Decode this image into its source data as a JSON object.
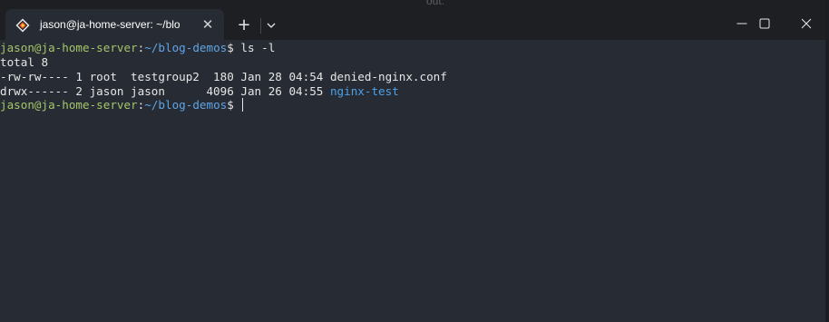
{
  "background_text": "out.",
  "tab": {
    "title": "jason@ja-home-server: ~/blo",
    "icon": "linux-penguin-icon"
  },
  "toolbar": {
    "new_tab_label": "+",
    "close_tab_label": "✕"
  },
  "colors": {
    "terminal_bg": "#272b33",
    "prompt_user": "#a4c66a",
    "prompt_path": "#5fa5e6",
    "directory": "#4ea0e8",
    "text": "#e6e6e6"
  },
  "terminal": {
    "prompt1": {
      "user_host": "jason@ja-home-server",
      "colon": ":",
      "path": "~/blog-demos",
      "symbol": "$",
      "command": " ls -l"
    },
    "total": "total 8",
    "file1": {
      "text": "-rw-rw---- 1 root  testgroup2  180 Jan 28 04:54 denied-nginx.conf"
    },
    "file2": {
      "meta": "drwx------ 2 jason jason      4096 Jan 26 04:55 ",
      "name": "nginx-test"
    },
    "prompt2": {
      "user_host": "jason@ja-home-server",
      "colon": ":",
      "path": "~/blog-demos",
      "symbol": "$",
      "command": " "
    }
  }
}
